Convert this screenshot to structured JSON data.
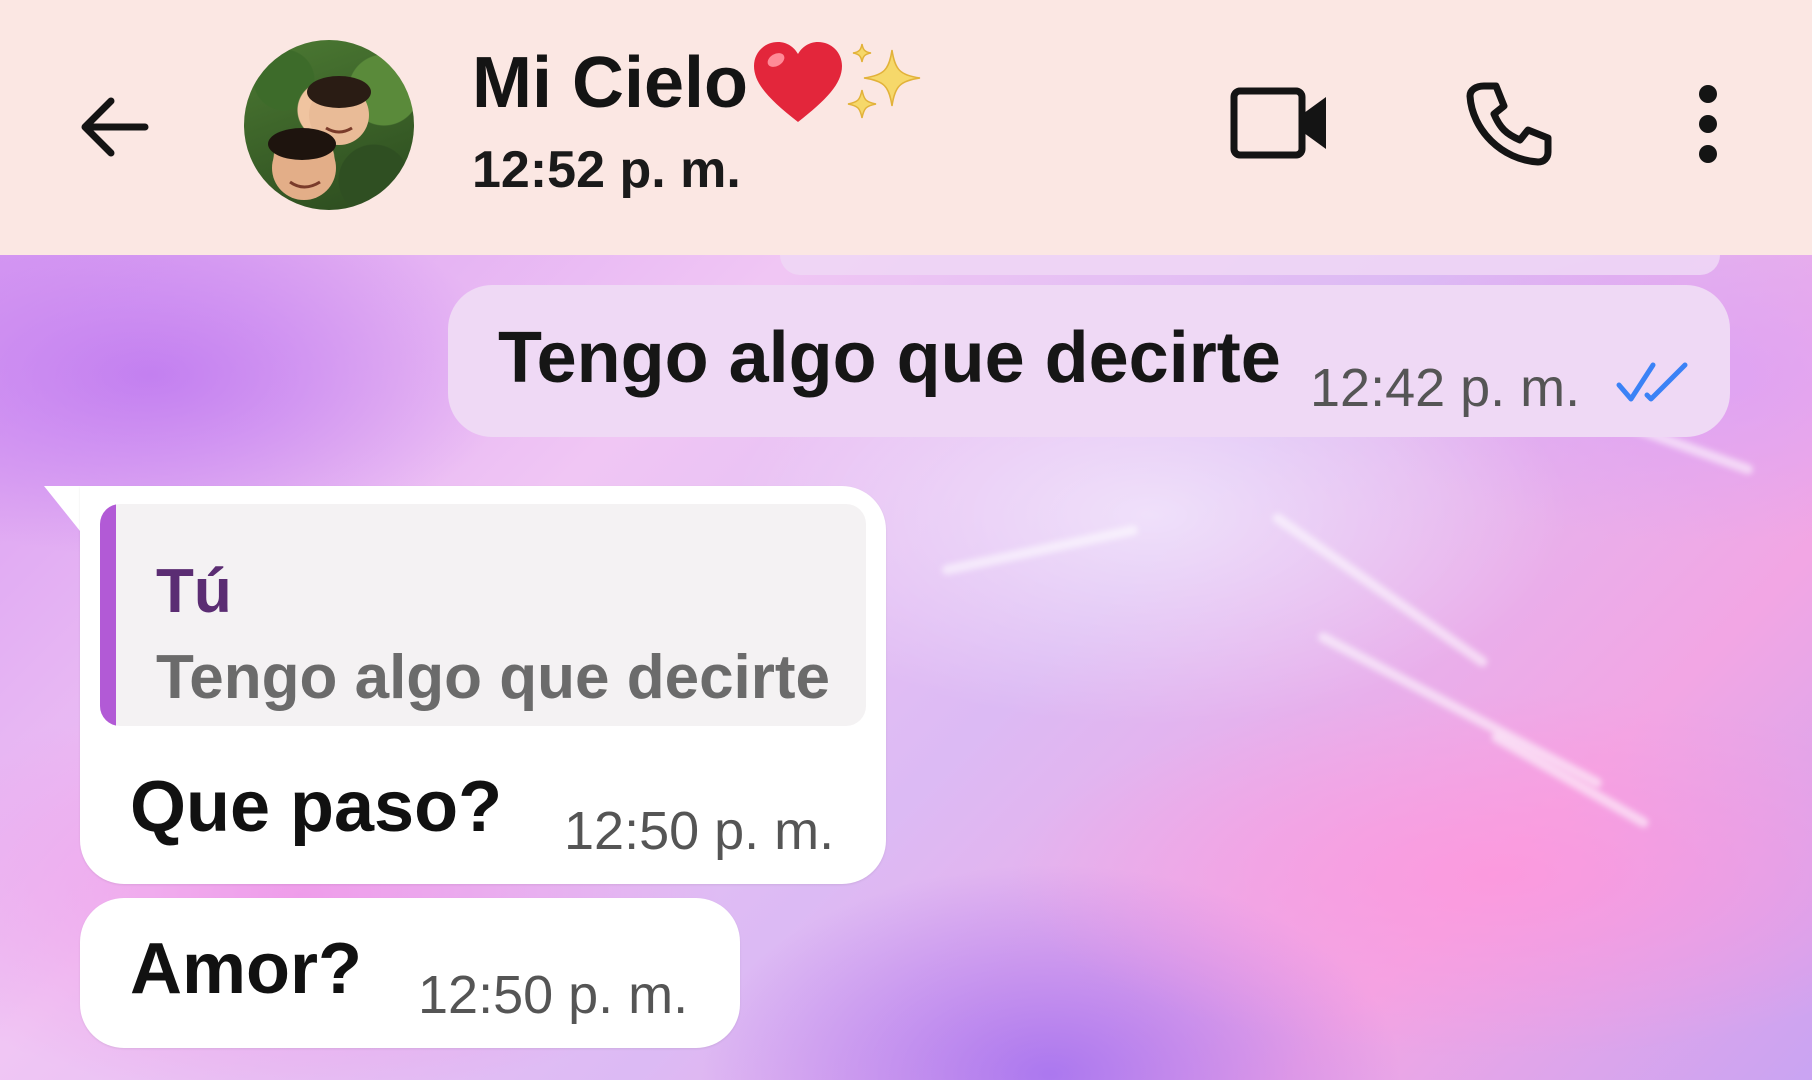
{
  "header": {
    "contact_name": "Mi Cielo",
    "name_emoji": [
      "red-heart",
      "sparkles"
    ],
    "status": "12:52 p. m.",
    "actions": [
      "back-arrow-icon",
      "video-camera-icon",
      "phone-icon",
      "more-vertical-icon"
    ],
    "background_color": "#fbe7e3"
  },
  "messages": [
    {
      "direction": "outgoing",
      "text": "Tengo algo que decirte",
      "time": "12:42 p. m.",
      "status_icon": "double-check-read",
      "status_color": "#3b82f6"
    },
    {
      "direction": "incoming",
      "reply_to": {
        "author": "Tú",
        "text": "Tengo algo que decirte"
      },
      "text": "Que paso?",
      "time": "12:50 p. m."
    },
    {
      "direction": "incoming",
      "text": "Amor?",
      "time": "12:50 p. m."
    }
  ],
  "colors": {
    "outgoing_bubble": "#efd9f5",
    "incoming_bubble": "#ffffff",
    "quote_bar": "#b25ad6",
    "quote_author": "#5b2d73"
  }
}
